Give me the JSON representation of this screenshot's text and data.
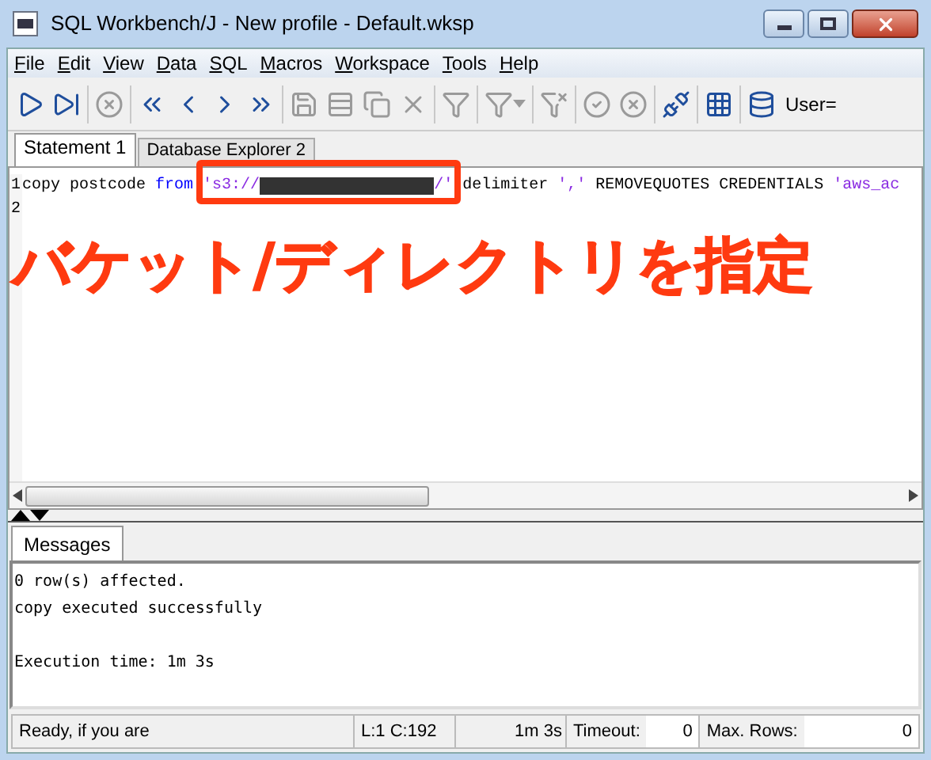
{
  "window": {
    "title": "SQL Workbench/J - New profile - Default.wksp"
  },
  "menu": [
    "File",
    "Edit",
    "View",
    "Data",
    "SQL",
    "Macros",
    "Workspace",
    "Tools",
    "Help"
  ],
  "toolbar": {
    "buttons": [
      {
        "kind": "run",
        "disabled": false
      },
      {
        "kind": "run-current",
        "disabled": false
      },
      {
        "kind": "stop",
        "disabled": true
      },
      {
        "kind": "first",
        "disabled": false
      },
      {
        "kind": "prev",
        "disabled": false
      },
      {
        "kind": "next",
        "disabled": false
      },
      {
        "kind": "last",
        "disabled": false
      },
      {
        "kind": "save",
        "disabled": true
      },
      {
        "kind": "insert-row",
        "disabled": true
      },
      {
        "kind": "copy-row",
        "disabled": true
      },
      {
        "kind": "delete",
        "disabled": true
      },
      {
        "kind": "filter",
        "disabled": true
      },
      {
        "kind": "filter-menu",
        "disabled": true
      },
      {
        "kind": "clear-filter",
        "disabled": true
      },
      {
        "kind": "commit",
        "disabled": true
      },
      {
        "kind": "rollback",
        "disabled": true
      },
      {
        "kind": "disconnect",
        "disabled": false
      },
      {
        "kind": "grid",
        "disabled": false
      },
      {
        "kind": "database",
        "disabled": false
      }
    ],
    "user": "User="
  },
  "tabs": [
    {
      "label": "Statement 1",
      "selected": true
    },
    {
      "label": "Database Explorer 2",
      "selected": false
    }
  ],
  "editor": {
    "line_numbers": [
      "1",
      "2"
    ],
    "line": [
      {
        "kind": "plain",
        "text": "copy postcode"
      },
      {
        "kind": "keyword",
        "text": "from"
      },
      {
        "kind": "string",
        "text": "'s3://"
      },
      {
        "kind": "redacted"
      },
      {
        "kind": "string",
        "text": "/'"
      },
      {
        "kind": "plain",
        "text": "delimiter"
      },
      {
        "kind": "string",
        "text": "','"
      },
      {
        "kind": "plain",
        "text": "REMOVEQUOTES CREDENTIALS"
      },
      {
        "kind": "string",
        "text": "'aws_ac"
      }
    ]
  },
  "annotation": {
    "text": "バケット/ディレクトリを指定"
  },
  "messages": {
    "tab": "Messages",
    "lines": [
      "0 row(s) affected.",
      "copy executed successfully"
    ],
    "summary": "Execution time: 1m 3s"
  },
  "status_bar": {
    "message": "Ready, if you are",
    "position": "L:1 C:192",
    "elapsed": "1m 3s",
    "timeout_label": "Timeout:",
    "timeout": "0",
    "max_rows_label": "Max. Rows:",
    "max_rows": "0"
  }
}
